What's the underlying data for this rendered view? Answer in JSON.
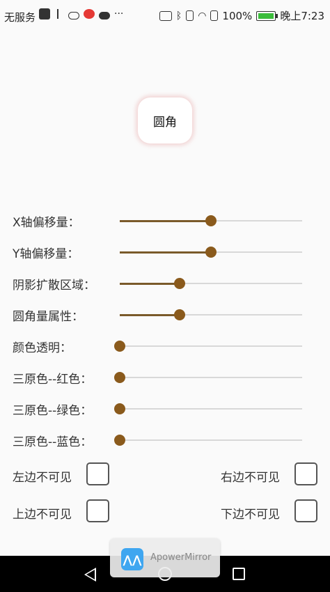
{
  "status_bar": {
    "carrier": "无服务",
    "more": "···",
    "battery_percent": "100%",
    "time": "晚上7:23"
  },
  "preview": {
    "label": "圆角"
  },
  "sliders": [
    {
      "label": "X轴偏移量：",
      "value": 0.5
    },
    {
      "label": "Y轴偏移量：",
      "value": 0.5
    },
    {
      "label": "阴影扩散区域：",
      "value": 0.33
    },
    {
      "label": "圆角量属性：",
      "value": 0.33
    },
    {
      "label": "颜色透明：",
      "value": 0.0
    },
    {
      "label": "三原色--红色：",
      "value": 0.0
    },
    {
      "label": "三原色--绿色：",
      "value": 0.0
    },
    {
      "label": "三原色--蓝色：",
      "value": 0.0
    }
  ],
  "checkboxes": {
    "left": "左边不可见",
    "right": "右边不可见",
    "top": "上边不可见",
    "bottom": "下边不可见"
  },
  "overlay": {
    "app_name": "ApowerMirror"
  },
  "colors": {
    "slider_active": "#7a5a2a",
    "slider_thumb": "#8a5a1c",
    "slider_track": "#d8d8d8",
    "preview_shadow": "#e69696",
    "battery_fill": "#3bbd3b"
  }
}
